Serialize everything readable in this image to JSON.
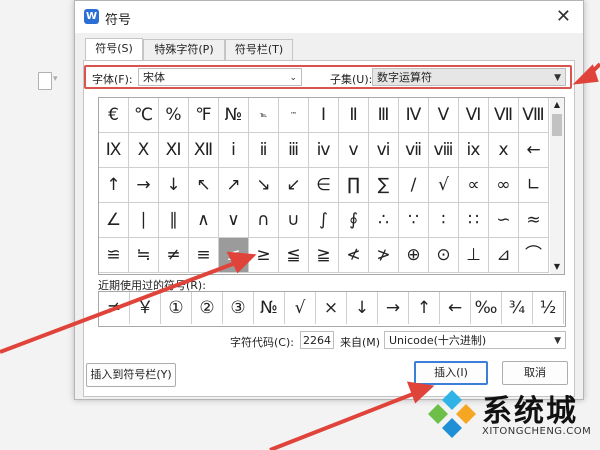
{
  "dialog": {
    "title": "符号",
    "close_glyph": "✕",
    "app_icon_letter": "W"
  },
  "tabs": [
    {
      "label": "符号(S)"
    },
    {
      "label": "特殊字符(P)"
    },
    {
      "label": "符号栏(T)"
    }
  ],
  "font_row": {
    "font_label": "字体(F):",
    "font_value": "宋体",
    "subset_label": "子集(U):",
    "subset_value": "数字运算符"
  },
  "symbols": [
    "€",
    "℃",
    "%",
    "℉",
    "№",
    "℡",
    "™",
    "Ⅰ",
    "Ⅱ",
    "Ⅲ",
    "Ⅳ",
    "Ⅴ",
    "Ⅵ",
    "Ⅶ",
    "Ⅷ",
    "Ⅸ",
    "Ⅹ",
    "Ⅺ",
    "Ⅻ",
    "ⅰ",
    "ⅱ",
    "ⅲ",
    "ⅳ",
    "ⅴ",
    "ⅵ",
    "ⅶ",
    "ⅷ",
    "ⅸ",
    "ⅹ",
    "←",
    "↑",
    "→",
    "↓",
    "↖",
    "↗",
    "↘",
    "↙",
    "∈",
    "∏",
    "∑",
    "∕",
    "√",
    "∝",
    "∞",
    "∟",
    "∠",
    "∣",
    "∥",
    "∧",
    "∨",
    "∩",
    "∪",
    "∫",
    "∮",
    "∴",
    "∵",
    "∶",
    "∷",
    "∽",
    "≈",
    "≌",
    "≒",
    "≠",
    "≡",
    "≤",
    "≥",
    "≦",
    "≧",
    "≮",
    "≯",
    "⊕",
    "⊙",
    "⊥",
    "⊿",
    "⌒"
  ],
  "selected_index": 64,
  "recent": {
    "label": "近期使用过的符号(R):",
    "symbols": [
      "≠",
      "￥",
      "①",
      "②",
      "③",
      "№",
      "√",
      "×",
      "↓",
      "→",
      "↑",
      "←",
      "‰",
      "¾",
      "½"
    ]
  },
  "code_row": {
    "code_label": "字符代码(C):",
    "code_value": "2264",
    "from_label": "来自(M)",
    "from_value": "Unicode(十六进制)"
  },
  "buttons": {
    "insert_to_bar": "插入到符号栏(Y)",
    "insert": "插入(I)",
    "cancel": "取消"
  },
  "watermark": {
    "text": "系统城",
    "sub": "XITONGCHENG.COM"
  },
  "colors": {
    "highlight_red": "#d9534f",
    "arrow_red": "#e0433a",
    "focus_blue": "#3c7fd8",
    "selected_cell": "#9b9b9b"
  }
}
